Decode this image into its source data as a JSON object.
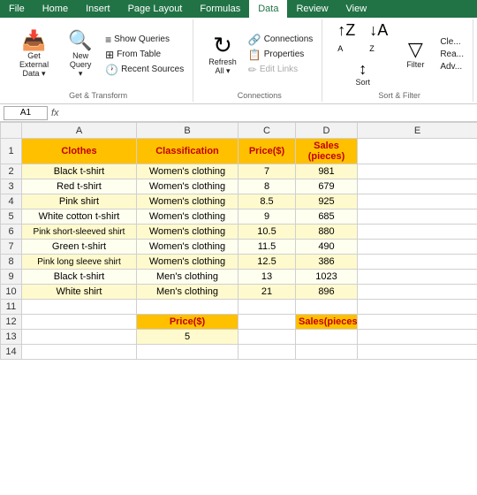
{
  "tabs": [
    {
      "label": "File"
    },
    {
      "label": "Home"
    },
    {
      "label": "Insert"
    },
    {
      "label": "Page Layout"
    },
    {
      "label": "Formulas"
    },
    {
      "label": "Data"
    },
    {
      "label": "Review"
    },
    {
      "label": "View"
    }
  ],
  "activeTab": "Data",
  "ribbon": {
    "groups": [
      {
        "name": "get-external-data",
        "label": "Get & Transform",
        "bigButtons": [
          {
            "id": "get-external-data",
            "icon": "📥",
            "label": "Get External\nData"
          },
          {
            "id": "new-query",
            "icon": "🔍",
            "label": "New\nQuery"
          }
        ],
        "smallButtons": [
          {
            "id": "show-queries",
            "icon": "≡",
            "label": "Show Queries"
          },
          {
            "id": "from-table",
            "icon": "⊞",
            "label": "From Table"
          },
          {
            "id": "recent-sources",
            "icon": "🕐",
            "label": "Recent Sources"
          }
        ]
      },
      {
        "name": "connections",
        "label": "Connections",
        "bigButtons": [
          {
            "id": "refresh-all",
            "icon": "↻",
            "label": "Refresh\nAll"
          }
        ],
        "smallButtons": [
          {
            "id": "connections",
            "icon": "🔗",
            "label": "Connections"
          },
          {
            "id": "properties",
            "icon": "📋",
            "label": "Properties"
          },
          {
            "id": "edit-links",
            "icon": "✏",
            "label": "Edit Links"
          }
        ]
      },
      {
        "name": "sort-filter",
        "label": "Sort & Filter",
        "bigButtons": [
          {
            "id": "sort-asc",
            "icon": "↑",
            "label": ""
          },
          {
            "id": "sort",
            "icon": "↕",
            "label": "Sort"
          },
          {
            "id": "filter",
            "icon": "▽",
            "label": "Filter"
          }
        ],
        "smallButtons": []
      }
    ]
  },
  "nameBox": "A1",
  "formulaBar": "",
  "colHeaders": [
    "",
    "A",
    "B",
    "C",
    "D"
  ],
  "rows": [
    {
      "num": "1",
      "cells": [
        {
          "val": "Clothes",
          "style": "orange-header"
        },
        {
          "val": "Classification",
          "style": "orange-header"
        },
        {
          "val": "Price($)",
          "style": "orange-header"
        },
        {
          "val": "Sales\n(pieces)",
          "style": "orange-sales"
        }
      ]
    },
    {
      "num": "2",
      "cells": [
        {
          "val": "Black t-shirt",
          "style": "yellow"
        },
        {
          "val": "Women's clothing",
          "style": "yellow"
        },
        {
          "val": "7",
          "style": "yellow"
        },
        {
          "val": "981",
          "style": "yellow"
        }
      ]
    },
    {
      "num": "3",
      "cells": [
        {
          "val": "Red t-shirt",
          "style": "light-yellow"
        },
        {
          "val": "Women's clothing",
          "style": "light-yellow"
        },
        {
          "val": "8",
          "style": "light-yellow"
        },
        {
          "val": "679",
          "style": "light-yellow"
        }
      ]
    },
    {
      "num": "4",
      "cells": [
        {
          "val": "Pink shirt",
          "style": "yellow"
        },
        {
          "val": "Women's clothing",
          "style": "yellow"
        },
        {
          "val": "8.5",
          "style": "yellow"
        },
        {
          "val": "925",
          "style": "yellow"
        }
      ]
    },
    {
      "num": "5",
      "cells": [
        {
          "val": "White cotton t-shirt",
          "style": "light-yellow"
        },
        {
          "val": "Women's clothing",
          "style": "light-yellow"
        },
        {
          "val": "9",
          "style": "light-yellow"
        },
        {
          "val": "685",
          "style": "light-yellow"
        }
      ]
    },
    {
      "num": "6",
      "cells": [
        {
          "val": "Pink short-sleeved shirt",
          "style": "yellow"
        },
        {
          "val": "Women's clothing",
          "style": "yellow"
        },
        {
          "val": "10.5",
          "style": "yellow"
        },
        {
          "val": "880",
          "style": "yellow"
        }
      ]
    },
    {
      "num": "7",
      "cells": [
        {
          "val": "Green t-shirt",
          "style": "light-yellow"
        },
        {
          "val": "Women's clothing",
          "style": "light-yellow"
        },
        {
          "val": "11.5",
          "style": "light-yellow"
        },
        {
          "val": "490",
          "style": "light-yellow"
        }
      ]
    },
    {
      "num": "8",
      "cells": [
        {
          "val": "Pink long sleeve shirt",
          "style": "yellow"
        },
        {
          "val": "Women's clothing",
          "style": "yellow"
        },
        {
          "val": "12.5",
          "style": "yellow"
        },
        {
          "val": "386",
          "style": "yellow"
        }
      ]
    },
    {
      "num": "9",
      "cells": [
        {
          "val": "Black t-shirt",
          "style": "light-yellow"
        },
        {
          "val": "Men's clothing",
          "style": "light-yellow"
        },
        {
          "val": "13",
          "style": "light-yellow"
        },
        {
          "val": "1023",
          "style": "light-yellow"
        }
      ]
    },
    {
      "num": "10",
      "cells": [
        {
          "val": "White shirt",
          "style": "yellow"
        },
        {
          "val": "Men's clothing",
          "style": "yellow"
        },
        {
          "val": "21",
          "style": "yellow"
        },
        {
          "val": "896",
          "style": "yellow"
        }
      ]
    },
    {
      "num": "11",
      "cells": [
        {
          "val": "",
          "style": ""
        },
        {
          "val": "",
          "style": ""
        },
        {
          "val": "",
          "style": ""
        },
        {
          "val": "",
          "style": ""
        }
      ]
    },
    {
      "num": "12",
      "cells": [
        {
          "val": "",
          "style": ""
        },
        {
          "val": "Price($)",
          "style": "orange-header-small"
        },
        {
          "val": "",
          "style": ""
        },
        {
          "val": "Sales(pieces)",
          "style": "orange-header-small"
        }
      ]
    },
    {
      "num": "13",
      "cells": [
        {
          "val": "",
          "style": ""
        },
        {
          "val": "5",
          "style": "yellow-small"
        },
        {
          "val": "",
          "style": ""
        },
        {
          "val": "",
          "style": ""
        }
      ]
    },
    {
      "num": "14",
      "cells": [
        {
          "val": "",
          "style": ""
        },
        {
          "val": "",
          "style": ""
        },
        {
          "val": "",
          "style": ""
        },
        {
          "val": "",
          "style": ""
        }
      ]
    }
  ]
}
